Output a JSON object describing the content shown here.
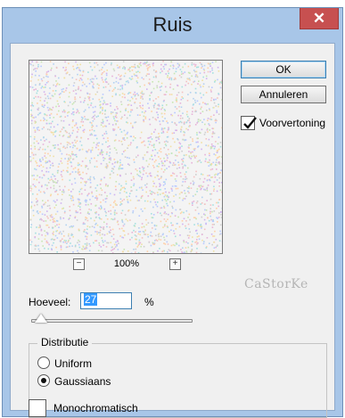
{
  "window": {
    "title": "Ruis",
    "close_label": "✕"
  },
  "buttons": {
    "ok": "OK",
    "cancel": "Annuleren"
  },
  "preview_toggle": {
    "label": "Voorvertoning",
    "checked": true
  },
  "zoom": {
    "minus": "⊟",
    "value": "100%",
    "plus": "⊞"
  },
  "watermark": "CaStorKe",
  "amount": {
    "label": "Hoeveel:",
    "value": "27",
    "unit": "%"
  },
  "distribution": {
    "legend": "Distributie",
    "options": [
      {
        "label": "Uniform",
        "selected": false
      },
      {
        "label": "Gaussiaans",
        "selected": true
      }
    ]
  },
  "monochrome": {
    "label": "Monochromatisch",
    "checked": false
  },
  "colors": {
    "title_bar": "#a8c6e8",
    "close_button": "#c75050",
    "selection": "#3399ff"
  }
}
